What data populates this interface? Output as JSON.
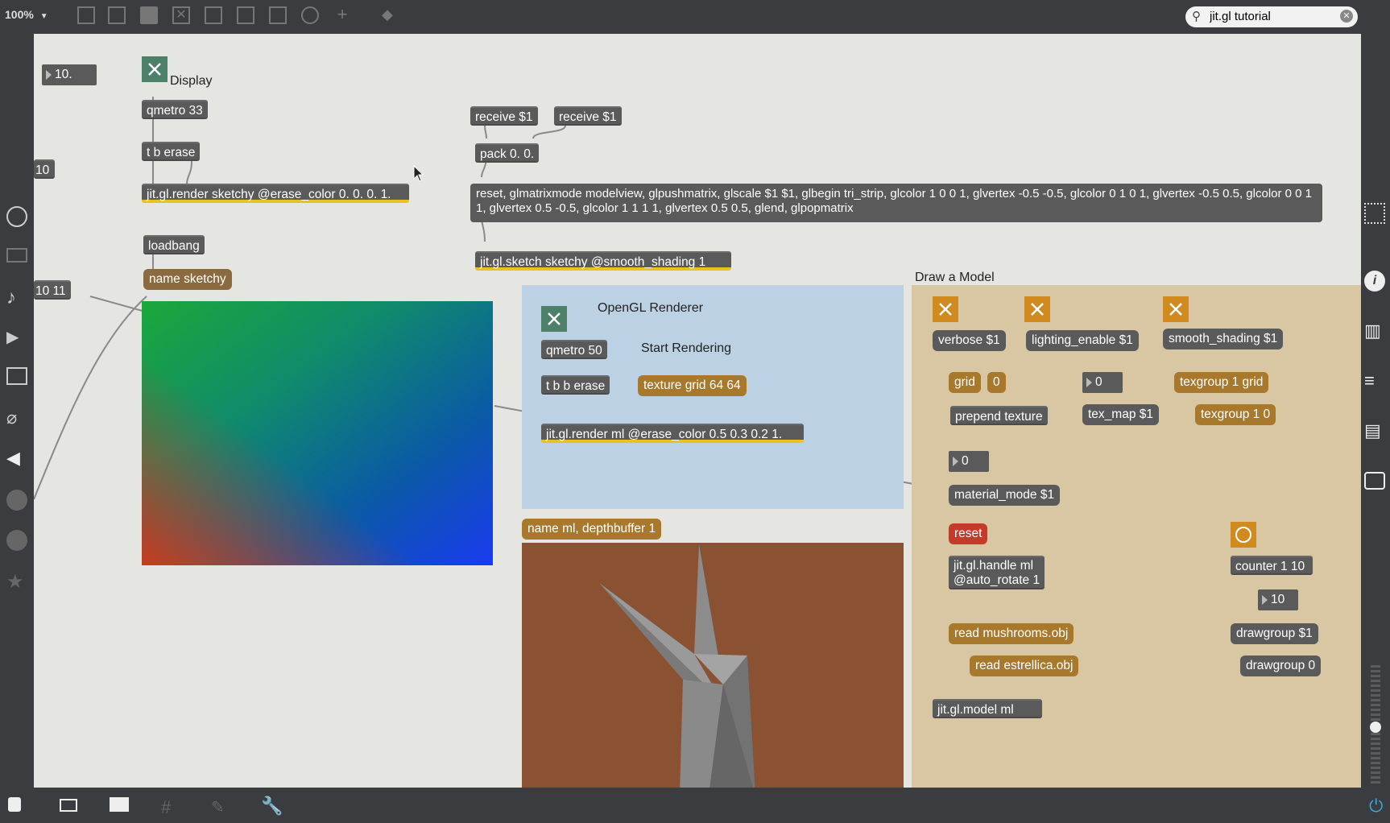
{
  "toolbar": {
    "zoom": "100%",
    "search_value": "jit.gl tutorial"
  },
  "left_widgets": {
    "num_10_top": "10.",
    "num_10_mid": "10",
    "pack_10_11": "10 11"
  },
  "display_section": {
    "title": "Display",
    "qmetro": "qmetro 33",
    "trigger": "t b erase",
    "render": "jit.gl.render sketchy @erase_color 0. 0. 0. 1.",
    "loadbang": "loadbang",
    "name_msg": "name sketchy"
  },
  "sketch_section": {
    "receive1": "receive $1",
    "receive2": "receive $1",
    "pack": "pack 0. 0.",
    "command_msg": "reset, glmatrixmode modelview, glpushmatrix, glscale $1 $1, glbegin tri_strip, glcolor 1 0 0 1, glvertex -0.5 -0.5, glcolor 0 1 0 1, glvertex -0.5 0.5, glcolor 0 0 1 1, glvertex 0.5 -0.5, glcolor 1 1 1 1, glvertex 0.5 0.5, glend, glpopmatrix",
    "sketch_obj": "jit.gl.sketch sketchy @smooth_shading 1"
  },
  "opengl_panel": {
    "title": "OpenGL Renderer",
    "start_label": "Start Rendering",
    "qmetro": "qmetro 50",
    "trigger": "t b b erase",
    "texture_msg": "texture grid 64 64",
    "render": "jit.gl.render ml @erase_color 0.5 0.3 0.2 1.",
    "name_msg": "name ml, depthbuffer 1"
  },
  "model_panel": {
    "title": "Draw a Model",
    "verbose": "verbose $1",
    "lighting": "lighting_enable $1",
    "smooth": "smooth_shading $1",
    "grid_msg": "grid",
    "zero_msg": "0",
    "num_0_a": "0",
    "texgroup_grid": "texgroup 1 grid",
    "prepend": "prepend texture",
    "texmap": "tex_map $1",
    "texgroup_10": "texgroup 1 0",
    "num_0_b": "0",
    "material": "material_mode $1",
    "reset": "reset",
    "handle": "jit.gl.handle ml\n@auto_rotate 1",
    "counter": "counter 1 10",
    "num_10": "10",
    "read_mushrooms": "read mushrooms.obj",
    "read_estrellica": "read estrellica.obj",
    "drawgroup_var": "drawgroup $1",
    "drawgroup_0": "drawgroup 0",
    "model_obj": "jit.gl.model ml"
  },
  "colors": {
    "canvas": "#e5e5e1",
    "object": "#5a5a5a",
    "message": "#8a6a3e",
    "opengl_panel": "#bdd1e4",
    "model_panel": "#d9c6a3",
    "render_bg": "#8a5232",
    "toggle": "#4d8068",
    "model_toggle": "#d08a1f",
    "reset": "#c43b2b"
  }
}
